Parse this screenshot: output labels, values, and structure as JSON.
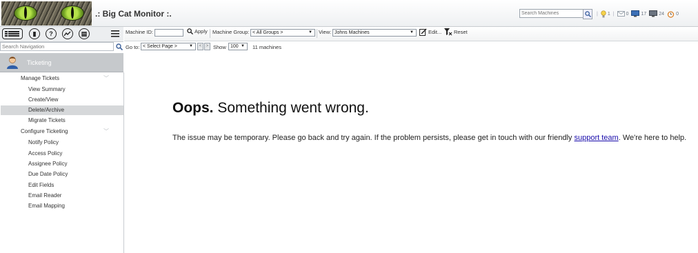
{
  "header": {
    "title": ".: Big Cat Monitor :.",
    "search_placeholder": "Search Machines",
    "stats": [
      {
        "icon": "lightbulb-icon",
        "value": "1"
      },
      {
        "icon": "envelope-icon",
        "value": "0"
      },
      {
        "icon": "monitor-icon",
        "value": "17"
      },
      {
        "icon": "computer-icon",
        "value": "24"
      },
      {
        "icon": "alarm-clock-icon",
        "value": "0"
      }
    ]
  },
  "nav": {
    "search_placeholder": "Search Navigation",
    "module": "Ticketing",
    "folders": [
      {
        "label": "Manage Tickets",
        "items": [
          "View Summary",
          "Create/View",
          "Delete/Archive",
          "Migrate Tickets"
        ]
      },
      {
        "label": "Configure Ticketing",
        "items": [
          "Notify Policy",
          "Access Policy",
          "Assignee Policy",
          "Due Date Policy",
          "Edit Fields",
          "Email Reader",
          "Email Mapping"
        ]
      }
    ],
    "selected_item": "Delete/Archive"
  },
  "toolbar": {
    "machine_id_label": "Machine ID:",
    "machine_id_value": "",
    "apply_label": "Apply",
    "machine_group_label": "Machine Group:",
    "machine_group_value": "< All Groups >",
    "view_label": "View:",
    "view_value": "Johns Machines",
    "edit_label": "Edit...",
    "reset_label": "Reset",
    "goto_label": "Go to:",
    "goto_value": "< Select Page >",
    "show_label": "Show",
    "show_value": "100",
    "machine_count": "11 machines"
  },
  "error": {
    "title_bold": "Oops.",
    "title_rest": "Something went wrong.",
    "body_before": "The issue may be temporary. Please go back and try again. If the problem persists, please get in touch with our friendly",
    "link": "support team",
    "body_after": ". We're here to help."
  }
}
